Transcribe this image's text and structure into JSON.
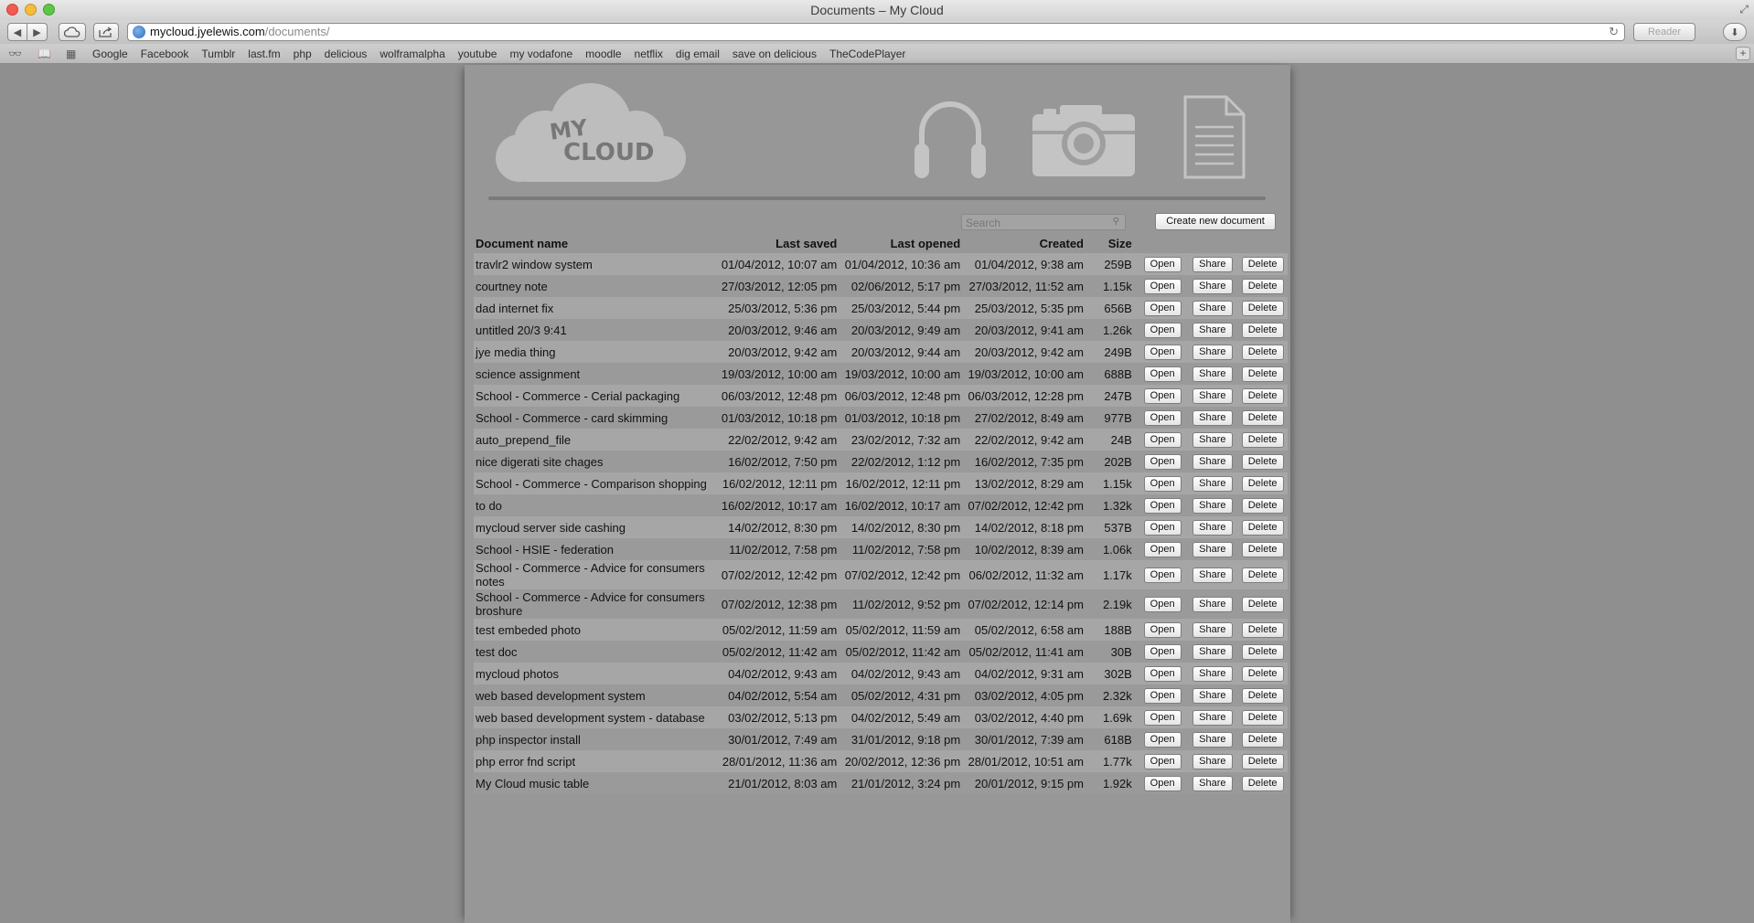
{
  "window": {
    "title": "Documents – My Cloud"
  },
  "browser": {
    "url_host": "mycloud.jyelewis.com",
    "url_path": "/documents/",
    "reader_label": "Reader",
    "bookmarks": [
      "Google",
      "Facebook",
      "Tumblr",
      "last.fm",
      "php",
      "delicious",
      "wolframalpha",
      "youtube",
      "my vodafone",
      "moodle",
      "netflix",
      "dig email",
      "save on delicious",
      "TheCodePlayer"
    ]
  },
  "header": {
    "logo_line1": "MY",
    "logo_line2": "CLOUD",
    "nav": [
      "headphones-icon",
      "camera-icon",
      "document-icon"
    ]
  },
  "search": {
    "placeholder": "Search"
  },
  "create_label": "Create new document",
  "table": {
    "columns": {
      "name": "Document name",
      "saved": "Last saved",
      "opened": "Last opened",
      "created": "Created",
      "size": "Size"
    },
    "actions": {
      "open": "Open",
      "share": "Share",
      "delete": "Delete"
    },
    "rows": [
      {
        "name": "travlr2 window system",
        "saved": "01/04/2012, 10:07 am",
        "opened": "01/04/2012, 10:36 am",
        "created": "01/04/2012, 9:38 am",
        "size": "259B"
      },
      {
        "name": "courtney note",
        "saved": "27/03/2012, 12:05 pm",
        "opened": "02/06/2012, 5:17 pm",
        "created": "27/03/2012, 11:52 am",
        "size": "1.15k"
      },
      {
        "name": "dad internet fix",
        "saved": "25/03/2012, 5:36 pm",
        "opened": "25/03/2012, 5:44 pm",
        "created": "25/03/2012, 5:35 pm",
        "size": "656B"
      },
      {
        "name": "untitled 20/3 9:41",
        "saved": "20/03/2012, 9:46 am",
        "opened": "20/03/2012, 9:49 am",
        "created": "20/03/2012, 9:41 am",
        "size": "1.26k"
      },
      {
        "name": "jye media thing",
        "saved": "20/03/2012, 9:42 am",
        "opened": "20/03/2012, 9:44 am",
        "created": "20/03/2012, 9:42 am",
        "size": "249B"
      },
      {
        "name": "science assignment",
        "saved": "19/03/2012, 10:00 am",
        "opened": "19/03/2012, 10:00 am",
        "created": "19/03/2012, 10:00 am",
        "size": "688B"
      },
      {
        "name": "School - Commerce - Cerial packaging",
        "saved": "06/03/2012, 12:48 pm",
        "opened": "06/03/2012, 12:48 pm",
        "created": "06/03/2012, 12:28 pm",
        "size": "247B"
      },
      {
        "name": "School - Commerce - card skimming",
        "saved": "01/03/2012, 10:18 pm",
        "opened": "01/03/2012, 10:18 pm",
        "created": "27/02/2012, 8:49 am",
        "size": "977B"
      },
      {
        "name": "auto_prepend_file",
        "saved": "22/02/2012, 9:42 am",
        "opened": "23/02/2012, 7:32 am",
        "created": "22/02/2012, 9:42 am",
        "size": "24B"
      },
      {
        "name": "nice digerati site chages",
        "saved": "16/02/2012, 7:50 pm",
        "opened": "22/02/2012, 1:12 pm",
        "created": "16/02/2012, 7:35 pm",
        "size": "202B"
      },
      {
        "name": "School - Commerce - Comparison shopping",
        "saved": "16/02/2012, 12:11 pm",
        "opened": "16/02/2012, 12:11 pm",
        "created": "13/02/2012, 8:29 am",
        "size": "1.15k"
      },
      {
        "name": "to do",
        "saved": "16/02/2012, 10:17 am",
        "opened": "16/02/2012, 10:17 am",
        "created": "07/02/2012, 12:42 pm",
        "size": "1.32k"
      },
      {
        "name": "mycloud server side cashing",
        "saved": "14/02/2012, 8:30 pm",
        "opened": "14/02/2012, 8:30 pm",
        "created": "14/02/2012, 8:18 pm",
        "size": "537B"
      },
      {
        "name": "School - HSIE - federation",
        "saved": "11/02/2012, 7:58 pm",
        "opened": "11/02/2012, 7:58 pm",
        "created": "10/02/2012, 8:39 am",
        "size": "1.06k"
      },
      {
        "name": "School - Commerce - Advice for consumers notes",
        "saved": "07/02/2012, 12:42 pm",
        "opened": "07/02/2012, 12:42 pm",
        "created": "06/02/2012, 11:32 am",
        "size": "1.17k",
        "tall": true
      },
      {
        "name": "School - Commerce - Advice for consumers broshure",
        "saved": "07/02/2012, 12:38 pm",
        "opened": "11/02/2012, 9:52 pm",
        "created": "07/02/2012, 12:14 pm",
        "size": "2.19k",
        "tall": true
      },
      {
        "name": "test embeded photo",
        "saved": "05/02/2012, 11:59 am",
        "opened": "05/02/2012, 11:59 am",
        "created": "05/02/2012, 6:58 am",
        "size": "188B"
      },
      {
        "name": "test doc",
        "saved": "05/02/2012, 11:42 am",
        "opened": "05/02/2012, 11:42 am",
        "created": "05/02/2012, 11:41 am",
        "size": "30B"
      },
      {
        "name": "mycloud photos",
        "saved": "04/02/2012, 9:43 am",
        "opened": "04/02/2012, 9:43 am",
        "created": "04/02/2012, 9:31 am",
        "size": "302B"
      },
      {
        "name": "web based development system",
        "saved": "04/02/2012, 5:54 am",
        "opened": "05/02/2012, 4:31 pm",
        "created": "03/02/2012, 4:05 pm",
        "size": "2.32k"
      },
      {
        "name": "web based development system - database",
        "saved": "03/02/2012, 5:13 pm",
        "opened": "04/02/2012, 5:49 am",
        "created": "03/02/2012, 4:40 pm",
        "size": "1.69k"
      },
      {
        "name": "php inspector install",
        "saved": "30/01/2012, 7:49 am",
        "opened": "31/01/2012, 9:18 pm",
        "created": "30/01/2012, 7:39 am",
        "size": "618B"
      },
      {
        "name": "php error fnd script",
        "saved": "28/01/2012, 11:36 am",
        "opened": "20/02/2012, 12:36 pm",
        "created": "28/01/2012, 10:51 am",
        "size": "1.77k"
      },
      {
        "name": "My Cloud music table",
        "saved": "21/01/2012, 8:03 am",
        "opened": "21/01/2012, 3:24 pm",
        "created": "20/01/2012, 9:15 pm",
        "size": "1.92k"
      }
    ]
  }
}
